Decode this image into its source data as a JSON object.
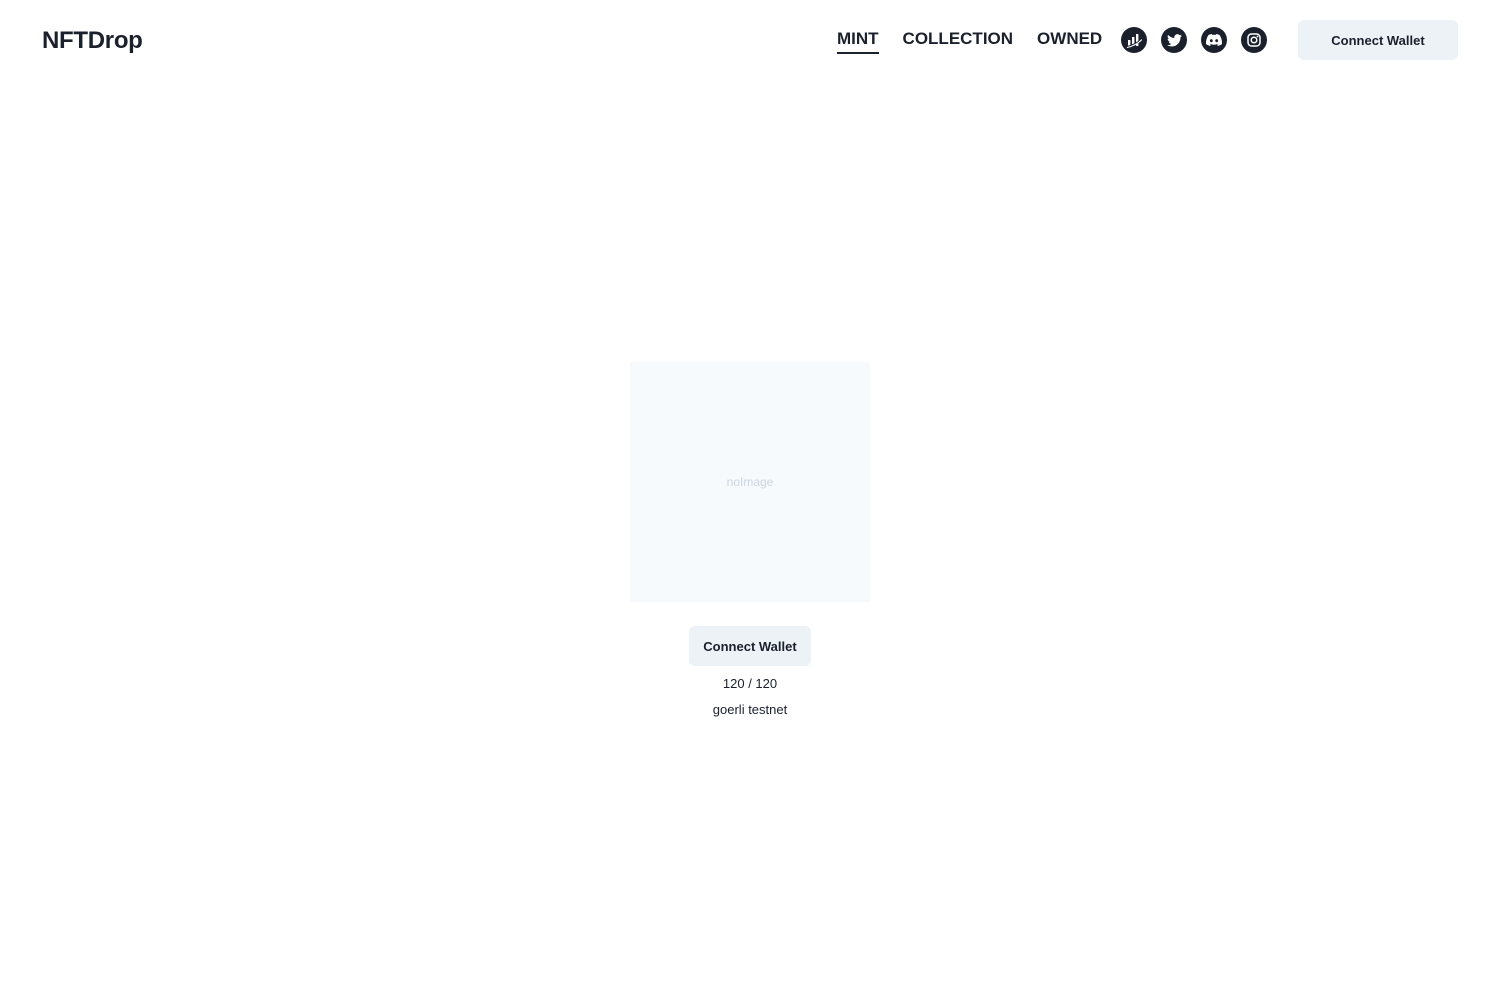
{
  "header": {
    "logo": "NFTDrop",
    "nav": [
      {
        "label": "MINT",
        "active": true
      },
      {
        "label": "COLLECTION",
        "active": false
      },
      {
        "label": "OWNED",
        "active": false
      }
    ],
    "socials": [
      "chart-icon",
      "twitter-icon",
      "discord-icon",
      "instagram-icon"
    ],
    "connect_label": "Connect Wallet"
  },
  "main": {
    "image_placeholder": "noImage",
    "connect_label": "Connect Wallet",
    "supply": "120 / 120",
    "network": "goerli testnet"
  },
  "colors": {
    "text": "#1a202c",
    "button_bg": "#edf2f7",
    "image_bg": "#f7fafc",
    "placeholder_text": "#cbd5e0"
  }
}
